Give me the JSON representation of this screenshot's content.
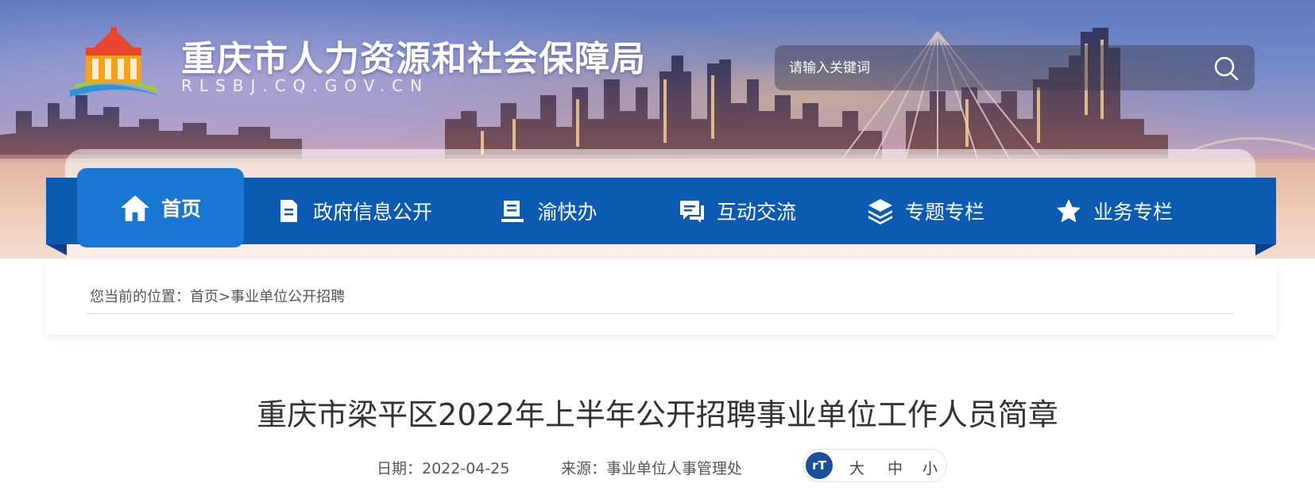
{
  "site": {
    "title": "重庆市人力资源和社会保障局",
    "domain": "RLSBJ.CQ.GOV.CN"
  },
  "search": {
    "placeholder": "请输入关键词"
  },
  "nav": {
    "items": [
      {
        "label": "首页",
        "icon": "home-icon"
      },
      {
        "label": "政府信息公开",
        "icon": "document-icon"
      },
      {
        "label": "渝快办",
        "icon": "book-icon"
      },
      {
        "label": "互动交流",
        "icon": "chat-icon"
      },
      {
        "label": "专题专栏",
        "icon": "layers-icon"
      },
      {
        "label": "业务专栏",
        "icon": "star-icon"
      }
    ],
    "active_index": 0
  },
  "breadcrumb": {
    "prefix": "您当前的位置：",
    "home": "首页",
    "separator": ">",
    "current": "事业单位公开招聘"
  },
  "article": {
    "title": "重庆市梁平区2022年上半年公开招聘事业单位工作人员简章",
    "date": "日期：2022-04-25",
    "source": "来源：事业单位人事管理处"
  },
  "font_size": {
    "icon_label": "rT",
    "large": "大",
    "medium": "中",
    "small": "小"
  },
  "colors": {
    "nav_blue": "#0b5bb3",
    "nav_active": "#1877d2",
    "switch_blue": "#1a4f99"
  }
}
